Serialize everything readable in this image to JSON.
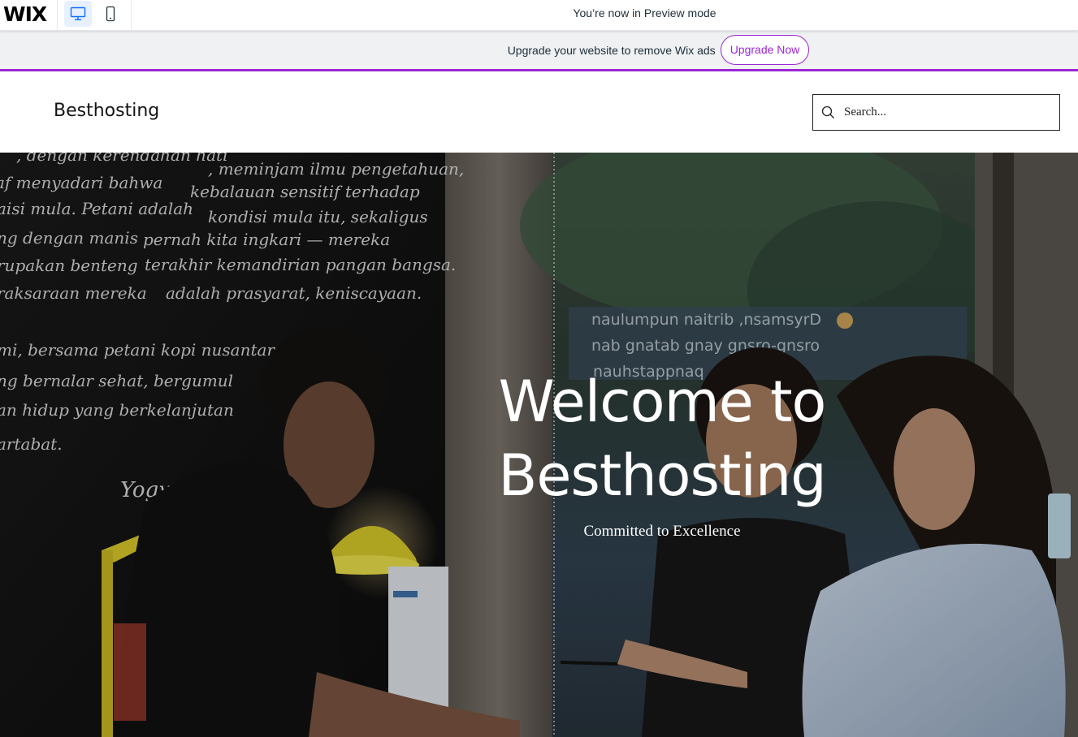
{
  "wix_bar": {
    "logo": "WIX",
    "preview_message": "You’re now in Preview mode",
    "devices": [
      {
        "name": "desktop",
        "icon": "desktop-icon",
        "active": true
      },
      {
        "name": "mobile",
        "icon": "mobile-icon",
        "active": false
      }
    ]
  },
  "upgrade_bar": {
    "message": "Upgrade your website to remove Wix ads",
    "button_label": "Upgrade Now",
    "accent_color": "#9a27d5"
  },
  "site_header": {
    "title": "Besthosting",
    "search": {
      "placeholder": "Search...",
      "value": "",
      "icon": "search-icon"
    }
  },
  "hero": {
    "title_line1": "Welcome to",
    "title_line2": "Besthosting",
    "subtitle": "Committed to Excellence",
    "chalkboard_lines": [
      ", dengan kerendahan hati",
      ", meminjam ilmu pengetahuan,",
      "af menyadari bahwa",
      "kebalauan sensitif terhadap",
      "aisi mula. Petani adalah",
      "kondisi mula itu, sekaligus",
      "ng dengan manis",
      "pernah kita ingkari — mereka",
      "rupakan benteng",
      "terakhir kemandirian pangan bangsa.",
      "raksaraan mereka",
      "adalah prasyarat, keniscayaan.",
      "mi, bersama petani kopi nusantara",
      "ng bernalar sehat, bergumul",
      "an hidup yang berkelanjutan",
      "artabat.",
      "Yogyakarta"
    ],
    "window_lines": [
      "naulumpun naitrib ,nsamsyrD",
      "nab gnatab gnay gnsro-gnsro",
      "nauhstappnaq"
    ]
  }
}
